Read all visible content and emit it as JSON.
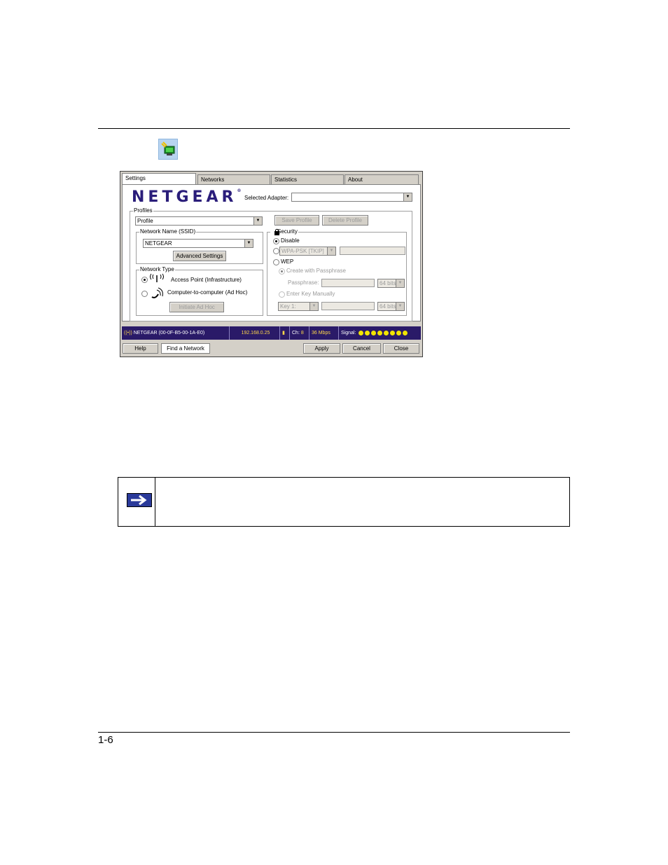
{
  "tray": {
    "icon": "wireless-monitor-icon"
  },
  "dialog": {
    "tabs": [
      "Settings",
      "Networks",
      "Statistics",
      "About"
    ],
    "brand": "NETGEAR",
    "brand_mark": "®",
    "selected_adapter_label": "Selected Adapter:",
    "selected_adapter_value": "",
    "profiles": {
      "title": "Profiles",
      "profile_value": "Profile",
      "save_profile": "Save Profile",
      "delete_profile": "Delete Profile"
    },
    "network_name": {
      "title": "Network Name (SSID)",
      "value": "NETGEAR",
      "advanced_settings": "Advanced Settings"
    },
    "network_type": {
      "title": "Network Type",
      "access_point": "Access Point (Infrastructure)",
      "computer_to_computer": "Computer-to-computer (Ad Hoc)",
      "initiate_adhoc": "Initiate Ad Hoc"
    },
    "security": {
      "title": "Security",
      "disable": "Disable",
      "wpa_psk": "WPA-PSK [TKIP]",
      "wep": "WEP",
      "create_with_passphrase": "Create with Passphrase",
      "passphrase_label": "Passphrase:",
      "bits_1": "64 bits",
      "enter_key_manually": "Enter Key Manually",
      "key_value": "Key 1:",
      "bits_2": "64 bits"
    },
    "status": {
      "network": "NETGEAR (00-0F-B5-00-1A-E0)",
      "ip": "192.168.0.25",
      "channel_label": "Ch:",
      "channel": "8",
      "speed": "36 Mbps",
      "signal_label": "Signal:",
      "signal_bars": 8
    },
    "buttons": {
      "help": "Help",
      "find_network": "Find a Network",
      "apply": "Apply",
      "cancel": "Cancel",
      "close": "Close"
    }
  },
  "note": {
    "icon": "right-arrow-icon"
  },
  "footer": {
    "page_number": "1-6"
  }
}
